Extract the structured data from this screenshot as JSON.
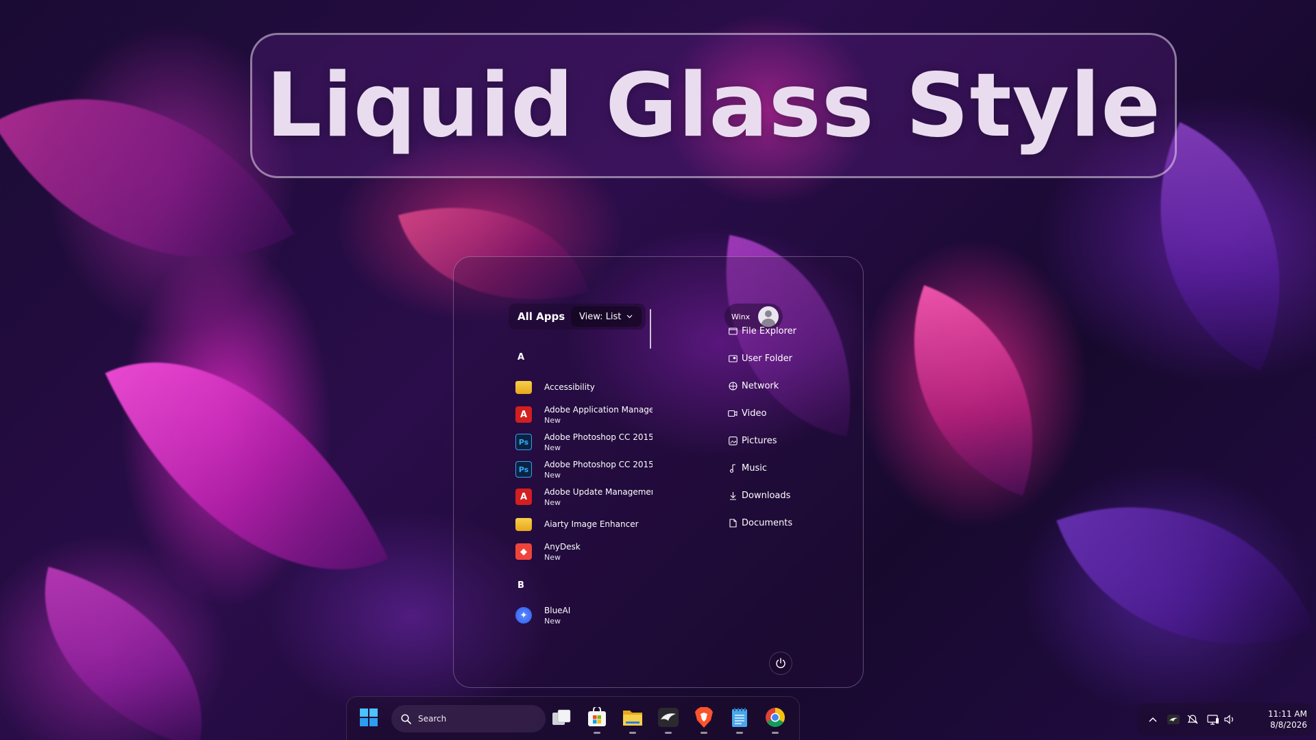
{
  "banner": {
    "title": "Liquid Glass Style"
  },
  "start_menu": {
    "all_apps_label": "All Apps",
    "view_label": "View: List",
    "user": {
      "name": "Winx"
    },
    "groups": [
      {
        "letter": "A",
        "apps": [
          {
            "name": "Accessibility",
            "badge": "",
            "icon": "folder-icon"
          },
          {
            "name": "Adobe Application Manage",
            "badge": "New",
            "icon": "adobe-icon"
          },
          {
            "name": "Adobe Photoshop CC 2015",
            "badge": "New",
            "icon": "photoshop-icon"
          },
          {
            "name": "Adobe Photoshop CC 2015",
            "badge": "New",
            "icon": "photoshop-icon"
          },
          {
            "name": "Adobe Update Managemer",
            "badge": "New",
            "icon": "adobe-icon"
          },
          {
            "name": "Aiarty Image Enhancer",
            "badge": "",
            "icon": "folder-icon"
          },
          {
            "name": "AnyDesk",
            "badge": "New",
            "icon": "anydesk-icon"
          }
        ]
      },
      {
        "letter": "B",
        "apps": [
          {
            "name": "BlueAI",
            "badge": "New",
            "icon": "blueai-icon"
          }
        ]
      }
    ],
    "places": [
      {
        "label": "File Explorer",
        "icon": "file-explorer-icon"
      },
      {
        "label": "User Folder",
        "icon": "user-folder-icon"
      },
      {
        "label": "Network",
        "icon": "network-icon"
      },
      {
        "label": "Video",
        "icon": "video-icon"
      },
      {
        "label": "Pictures",
        "icon": "pictures-icon"
      },
      {
        "label": "Music",
        "icon": "music-icon"
      },
      {
        "label": "Downloads",
        "icon": "downloads-icon"
      },
      {
        "label": "Documents",
        "icon": "documents-icon"
      }
    ]
  },
  "taskbar": {
    "search_label": "Search",
    "apps": [
      "windows-start-icon",
      "task-view-icon",
      "microsoft-store-icon",
      "file-explorer-icon",
      "eagle-app-icon",
      "brave-browser-icon",
      "notepad-icon",
      "chrome-icon"
    ]
  },
  "tray": {
    "time": "11:11 AM",
    "date": "8/8/2026"
  },
  "colors": {
    "accent": "#c040d0",
    "banner_text": "#e9dcef",
    "adobe_red": "#d21f1f",
    "photoshop_blue": "#31a8ff"
  }
}
